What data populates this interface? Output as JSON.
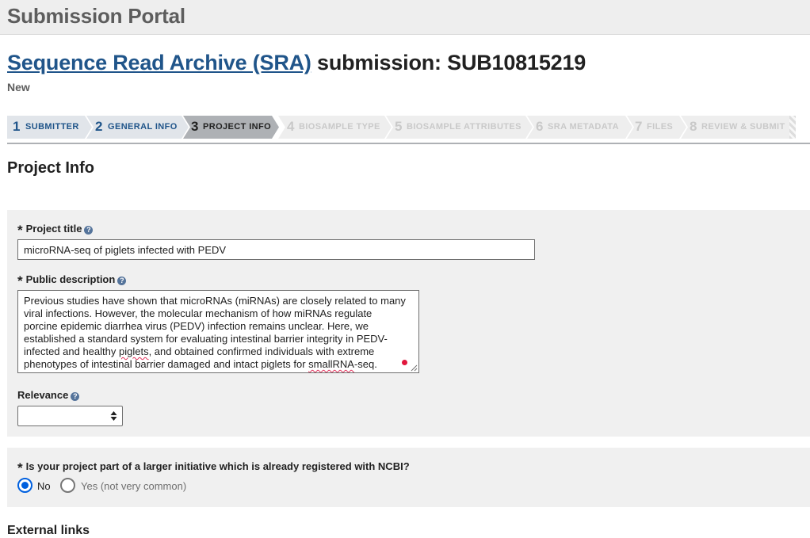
{
  "portal": {
    "title": "Submission Portal"
  },
  "submission": {
    "archive_link": "Sequence Read Archive (SRA)",
    "title_suffix": " submission: SUB10815219",
    "status": "New"
  },
  "steps": [
    {
      "num": "1",
      "label": "SUBMITTER",
      "state": "done"
    },
    {
      "num": "2",
      "label": "GENERAL INFO",
      "state": "done"
    },
    {
      "num": "3",
      "label": "PROJECT INFO",
      "state": "current"
    },
    {
      "num": "4",
      "label": "BIOSAMPLE TYPE",
      "state": "future"
    },
    {
      "num": "5",
      "label": "BIOSAMPLE ATTRIBUTES",
      "state": "future"
    },
    {
      "num": "6",
      "label": "SRA METADATA",
      "state": "future"
    },
    {
      "num": "7",
      "label": "FILES",
      "state": "future"
    },
    {
      "num": "8",
      "label": "REVIEW & SUBMIT",
      "state": "future"
    }
  ],
  "section": {
    "title": "Project Info"
  },
  "form": {
    "required_mark": "*",
    "help_glyph": "?",
    "project_title": {
      "label": "Project title",
      "value": "microRNA-seq of piglets infected with PEDV"
    },
    "public_description": {
      "label": "Public description",
      "value": "Previous studies have shown that microRNAs (miRNAs) are closely related to many viral infections. However, the molecular mechanism of how miRNAs regulate porcine epidemic diarrhea virus (PEDV) infection remains unclear. Here, we established a standard system for evaluating intestinal barrier integrity in PEDV-infected and healthy piglets, and obtained confirmed individuals with extreme phenotypes of intestinal barrier damaged and intact piglets for smallRNA-seq.",
      "lines": [
        "Previous studies have shown that microRNAs (miRNAs) are closely related to many",
        "viral infections. However, the molecular mechanism of how miRNAs regulate",
        "porcine epidemic diarrhea virus (PEDV) infection remains unclear. Here, we",
        "established a standard system for evaluating intestinal barrier integrity in PEDV-",
        "infected and healthy ",
        "piglets",
        ", and obtained confirmed individuals with extreme",
        "phenotypes of intestinal barrier damaged and intact piglets for ",
        "smallRNA",
        "-seq."
      ]
    },
    "relevance": {
      "label": "Relevance",
      "selected": ""
    },
    "initiative": {
      "question": "Is your project part of a larger initiative which is already registered with NCBI?",
      "options": [
        {
          "label": "No",
          "checked": true
        },
        {
          "label": "Yes (not very common)",
          "checked": false
        }
      ]
    }
  },
  "external_links": {
    "title": "External links"
  },
  "colors": {
    "link_blue": "#20558a",
    "step_done_bg": "#e1e5ea",
    "step_current_bg": "#aeb1b5",
    "step_future_bg": "#eeeeee",
    "panel_bg": "#f0f0f0",
    "radio_checked": "#0060df",
    "spellcheck_underline": "#e0305a"
  },
  "icons": {
    "help": "question-circle-icon",
    "select_arrows": "sort-arrows-icon",
    "grammar": "grammarly-dot-icon",
    "resize": "resize-grip-icon"
  }
}
